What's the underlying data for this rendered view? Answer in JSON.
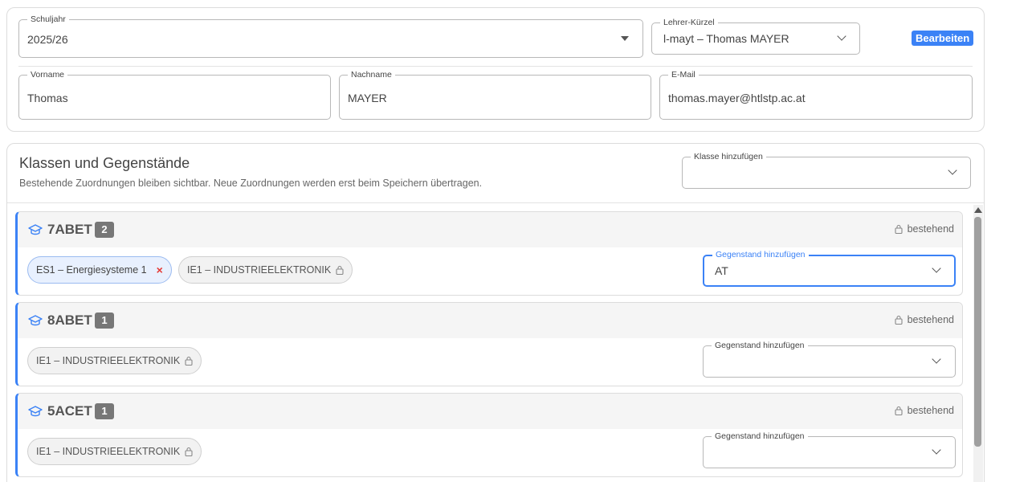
{
  "top": {
    "schuljahr": {
      "label": "Schuljahr",
      "value": "2025/26"
    },
    "lehrer": {
      "label": "Lehrer-Kürzel",
      "value": "l-mayt – Thomas MAYER"
    },
    "edit_label": "Bearbeiten",
    "vorname": {
      "label": "Vorname",
      "value": "Thomas"
    },
    "nachname": {
      "label": "Nachname",
      "value": "MAYER"
    },
    "email": {
      "label": "E-Mail",
      "value": "thomas.mayer@htlstp.ac.at"
    }
  },
  "classes_section": {
    "title": "Klassen und Gegenstände",
    "subtitle": "Bestehende Zuordnungen bleiben sichtbar. Neue Zuordnungen werden erst beim Speichern übertragen.",
    "add_class_label": "Klasse hinzufügen",
    "add_class_value": ""
  },
  "classes": [
    {
      "name": "7ABET",
      "count": "2",
      "status": "bestehend",
      "subjects": [
        {
          "label": "ES1 – Energiesysteme 1",
          "kind": "new"
        },
        {
          "label": "IE1 – INDUSTRIEELEKTRONIK",
          "kind": "existing"
        }
      ],
      "add_subject_label": "Gegenstand hinzufügen",
      "add_subject_value": "AT"
    },
    {
      "name": "8ABET",
      "count": "1",
      "status": "bestehend",
      "subjects": [
        {
          "label": "IE1 – INDUSTRIEELEKTRONIK",
          "kind": "existing"
        }
      ],
      "add_subject_label": "Gegenstand hinzufügen",
      "add_subject_value": ""
    },
    {
      "name": "5ACET",
      "count": "1",
      "status": "bestehend",
      "subjects": [
        {
          "label": "IE1 – INDUSTRIEELEKTRONIK",
          "kind": "existing"
        }
      ],
      "add_subject_label": "Gegenstand hinzufügen",
      "add_subject_value": ""
    }
  ],
  "icons": {
    "class": "graduation-cap-icon",
    "lock": "lock-icon",
    "remove": "close-icon",
    "dropdown": "chevron-down-icon"
  },
  "colors": {
    "accent": "#3b82f6",
    "remove": "#e53935",
    "badge": "#777777"
  }
}
